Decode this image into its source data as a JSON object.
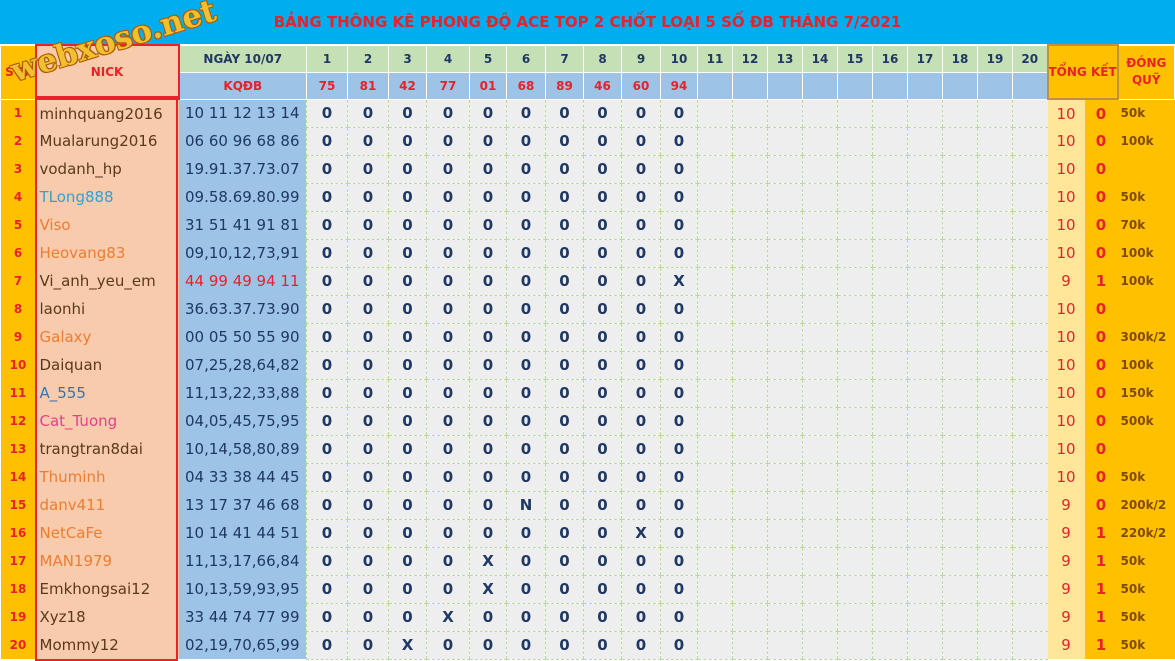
{
  "title": "BẢNG THÔNG KÊ PHONG ĐỘ ACE TOP 2 CHỐT LOẠI 5 SỐ ĐB THÁNG 7/2021",
  "watermark": "webxoso.net",
  "header": {
    "stt": "STT",
    "nick": "NICK",
    "date": "NGÀY 10/07",
    "kqdb": "KQĐB",
    "tong_ket": "TỔNG KẾT",
    "dong_quy": "ĐÓNG QUỸ",
    "days": [
      "1",
      "2",
      "3",
      "4",
      "5",
      "6",
      "7",
      "8",
      "9",
      "10",
      "11",
      "12",
      "13",
      "14",
      "15",
      "16",
      "17",
      "18",
      "19",
      "20"
    ],
    "results": [
      "75",
      "81",
      "42",
      "77",
      "01",
      "68",
      "89",
      "46",
      "60",
      "94",
      "",
      "",
      "",
      "",
      "",
      "",
      "",
      "",
      "",
      ""
    ]
  },
  "colors": {
    "title_bg": "#00aeef",
    "title_text": "#e8212a",
    "stt_bg": "#ffc000",
    "nick_bg": "#f8cbad",
    "numbers_bg": "#9dc3e6",
    "day_cell_bg": "#eeeeee",
    "nick_dark": "#5a3a1a",
    "nick_orange": "#ed7d31",
    "nick_blue": "#2e75b6",
    "nick_cyan": "#2ea2d8",
    "nick_pink": "#e83e8c"
  },
  "rows": [
    {
      "stt": "1",
      "nick": "minhquang2016",
      "nick_color": "#5a3a1a",
      "numbers": "10 11 12 13 14",
      "numbers_color": "#1f3864",
      "days": [
        "0",
        "0",
        "0",
        "0",
        "0",
        "0",
        "0",
        "0",
        "0",
        "0"
      ],
      "total": "10",
      "miss": "0",
      "fund": "50k"
    },
    {
      "stt": "2",
      "nick": "Mualarung2016",
      "nick_color": "#5a3a1a",
      "numbers": "06 60 96 68 86",
      "numbers_color": "#1f3864",
      "days": [
        "0",
        "0",
        "0",
        "0",
        "0",
        "0",
        "0",
        "0",
        "0",
        "0"
      ],
      "total": "10",
      "miss": "0",
      "fund": "100k"
    },
    {
      "stt": "3",
      "nick": "vodanh_hp",
      "nick_color": "#5a3a1a",
      "numbers": "19.91.37.73.07",
      "numbers_color": "#1f3864",
      "days": [
        "0",
        "0",
        "0",
        "0",
        "0",
        "0",
        "0",
        "0",
        "0",
        "0"
      ],
      "total": "10",
      "miss": "0",
      "fund": ""
    },
    {
      "stt": "4",
      "nick": "TLong888",
      "nick_color": "#2ea2d8",
      "numbers": "09.58.69.80.99",
      "numbers_color": "#1f3864",
      "days": [
        "0",
        "0",
        "0",
        "0",
        "0",
        "0",
        "0",
        "0",
        "0",
        "0"
      ],
      "total": "10",
      "miss": "0",
      "fund": "50k"
    },
    {
      "stt": "5",
      "nick": "Viso",
      "nick_color": "#ed7d31",
      "numbers": "31 51 41 91 81",
      "numbers_color": "#1f3864",
      "days": [
        "0",
        "0",
        "0",
        "0",
        "0",
        "0",
        "0",
        "0",
        "0",
        "0"
      ],
      "total": "10",
      "miss": "0",
      "fund": "70k"
    },
    {
      "stt": "6",
      "nick": "Heovang83",
      "nick_color": "#ed7d31",
      "numbers": "09,10,12,73,91",
      "numbers_color": "#1f3864",
      "days": [
        "0",
        "0",
        "0",
        "0",
        "0",
        "0",
        "0",
        "0",
        "0",
        "0"
      ],
      "total": "10",
      "miss": "0",
      "fund": "100k"
    },
    {
      "stt": "7",
      "nick": "Vi_anh_yeu_em",
      "nick_color": "#5a3a1a",
      "numbers": "44 99 49 94 11",
      "numbers_color": "#e8212a",
      "days": [
        "0",
        "0",
        "0",
        "0",
        "0",
        "0",
        "0",
        "0",
        "0",
        "X"
      ],
      "total": "9",
      "miss": "1",
      "fund": "100k"
    },
    {
      "stt": "8",
      "nick": "laonhi",
      "nick_color": "#5a3a1a",
      "numbers": "36.63.37.73.90",
      "numbers_color": "#1f3864",
      "days": [
        "0",
        "0",
        "0",
        "0",
        "0",
        "0",
        "0",
        "0",
        "0",
        "0"
      ],
      "total": "10",
      "miss": "0",
      "fund": ""
    },
    {
      "stt": "9",
      "nick": "Galaxy",
      "nick_color": "#ed7d31",
      "numbers": "00 05 50 55 90",
      "numbers_color": "#1f3864",
      "days": [
        "0",
        "0",
        "0",
        "0",
        "0",
        "0",
        "0",
        "0",
        "0",
        "0"
      ],
      "total": "10",
      "miss": "0",
      "fund": "300k/2"
    },
    {
      "stt": "10",
      "nick": "Daiquan",
      "nick_color": "#5a3a1a",
      "numbers": "07,25,28,64,82",
      "numbers_color": "#1f3864",
      "days": [
        "0",
        "0",
        "0",
        "0",
        "0",
        "0",
        "0",
        "0",
        "0",
        "0"
      ],
      "total": "10",
      "miss": "0",
      "fund": "100k"
    },
    {
      "stt": "11",
      "nick": "A_555",
      "nick_color": "#2e75b6",
      "numbers": "11,13,22,33,88",
      "numbers_color": "#1f3864",
      "days": [
        "0",
        "0",
        "0",
        "0",
        "0",
        "0",
        "0",
        "0",
        "0",
        "0"
      ],
      "total": "10",
      "miss": "0",
      "fund": "150k"
    },
    {
      "stt": "12",
      "nick": "Cat_Tuong",
      "nick_color": "#e83e8c",
      "numbers": "04,05,45,75,95",
      "numbers_color": "#1f3864",
      "days": [
        "0",
        "0",
        "0",
        "0",
        "0",
        "0",
        "0",
        "0",
        "0",
        "0"
      ],
      "total": "10",
      "miss": "0",
      "fund": "500k"
    },
    {
      "stt": "13",
      "nick": "trangtran8dai",
      "nick_color": "#5a3a1a",
      "numbers": "10,14,58,80,89",
      "numbers_color": "#1f3864",
      "days": [
        "0",
        "0",
        "0",
        "0",
        "0",
        "0",
        "0",
        "0",
        "0",
        "0"
      ],
      "total": "10",
      "miss": "0",
      "fund": ""
    },
    {
      "stt": "14",
      "nick": "Thuminh",
      "nick_color": "#ed7d31",
      "numbers": "04 33 38 44 45",
      "numbers_color": "#1f3864",
      "days": [
        "0",
        "0",
        "0",
        "0",
        "0",
        "0",
        "0",
        "0",
        "0",
        "0"
      ],
      "total": "10",
      "miss": "0",
      "fund": "50k"
    },
    {
      "stt": "15",
      "nick": "danv411",
      "nick_color": "#ed7d31",
      "numbers": "13 17 37 46 68",
      "numbers_color": "#1f3864",
      "days": [
        "0",
        "0",
        "0",
        "0",
        "0",
        "N",
        "0",
        "0",
        "0",
        "0"
      ],
      "total": "9",
      "miss": "0",
      "fund": "200k/2"
    },
    {
      "stt": "16",
      "nick": "NetCaFe",
      "nick_color": "#ed7d31",
      "numbers": "10 14 41 44 51",
      "numbers_color": "#1f3864",
      "days": [
        "0",
        "0",
        "0",
        "0",
        "0",
        "0",
        "0",
        "0",
        "X",
        "0"
      ],
      "total": "9",
      "miss": "1",
      "fund": "220k/2"
    },
    {
      "stt": "17",
      "nick": "MAN1979",
      "nick_color": "#ed7d31",
      "numbers": "11,13,17,66,84",
      "numbers_color": "#1f3864",
      "days": [
        "0",
        "0",
        "0",
        "0",
        "X",
        "0",
        "0",
        "0",
        "0",
        "0"
      ],
      "total": "9",
      "miss": "1",
      "fund": "50k"
    },
    {
      "stt": "18",
      "nick": "Emkhongsai12",
      "nick_color": "#5a3a1a",
      "numbers": "10,13,59,93,95",
      "numbers_color": "#1f3864",
      "days": [
        "0",
        "0",
        "0",
        "0",
        "X",
        "0",
        "0",
        "0",
        "0",
        "0"
      ],
      "total": "9",
      "miss": "1",
      "fund": "50k"
    },
    {
      "stt": "19",
      "nick": "Xyz18",
      "nick_color": "#5a3a1a",
      "numbers": "33 44 74 77 99",
      "numbers_color": "#1f3864",
      "days": [
        "0",
        "0",
        "0",
        "X",
        "0",
        "0",
        "0",
        "0",
        "0",
        "0"
      ],
      "total": "9",
      "miss": "1",
      "fund": "50k"
    },
    {
      "stt": "20",
      "nick": "Mommy12",
      "nick_color": "#5a3a1a",
      "numbers": "02,19,70,65,99",
      "numbers_color": "#1f3864",
      "days": [
        "0",
        "0",
        "X",
        "0",
        "0",
        "0",
        "0",
        "0",
        "0",
        "0"
      ],
      "total": "9",
      "miss": "1",
      "fund": "50k"
    }
  ]
}
